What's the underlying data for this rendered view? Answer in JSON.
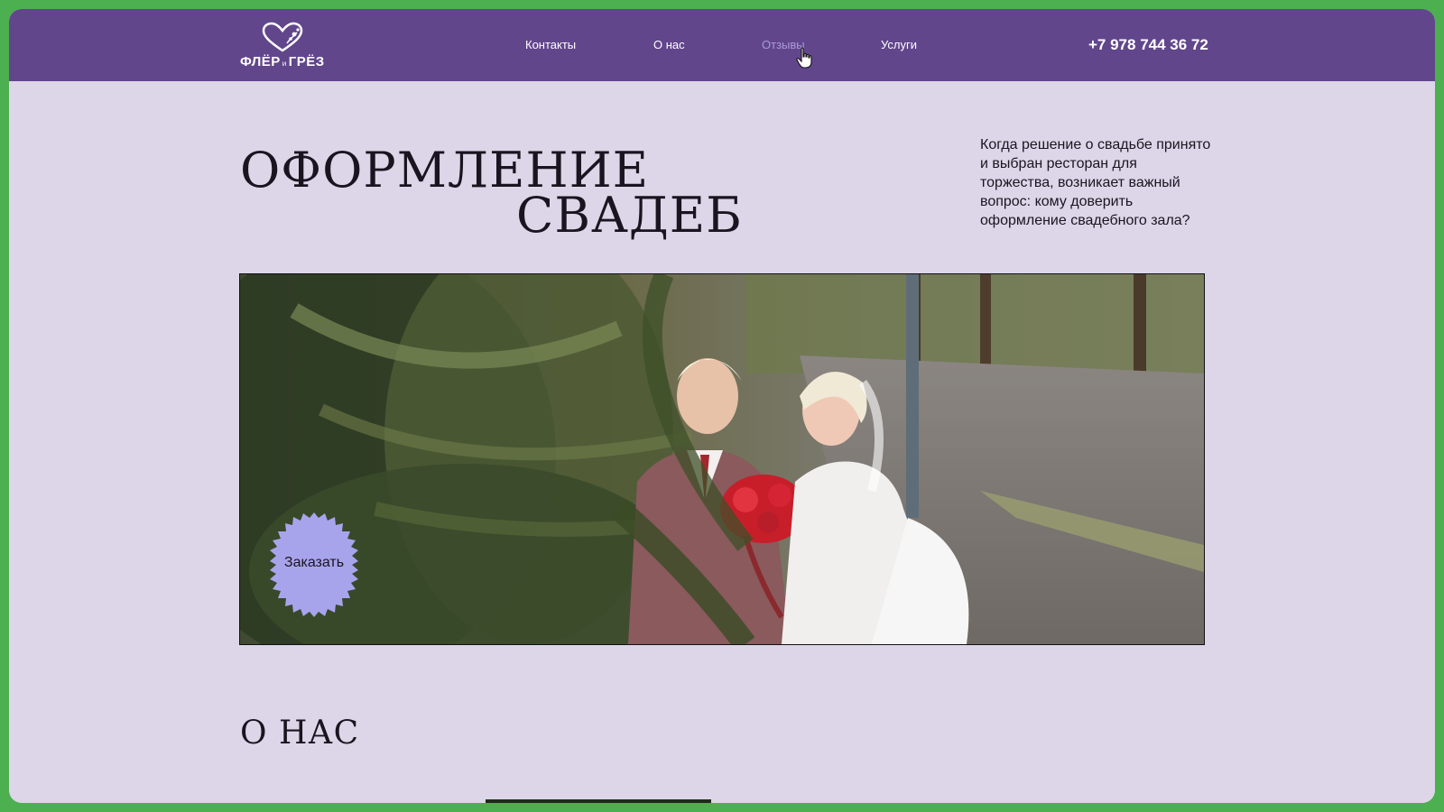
{
  "header": {
    "logo_text_left": "ФЛЁР",
    "logo_text_mid": "и",
    "logo_text_right": "ГРЁЗ",
    "nav": [
      {
        "label": "Контакты"
      },
      {
        "label": "О нас"
      },
      {
        "label": "Отзывы"
      },
      {
        "label": "Услуги"
      }
    ],
    "active_nav": "Отзывы",
    "phone": "+7 978 744 36 72"
  },
  "hero": {
    "title_line1": "ОФОРМЛЕНИЕ",
    "title_line2": "СВАДЕБ",
    "intro": "Когда решение о свадьбе принято и выбран ресторан для торжества, возникает важный вопрос: кому доверить оформление свадебного зала?",
    "image_icon": "wedding-couple-photo",
    "order_button": "Заказать"
  },
  "sections": {
    "about_title": "О НАС"
  },
  "colors": {
    "page_bg": "#dcd6e8",
    "header_bg": "#62468c",
    "accent": "#a99bd8",
    "order_badge": "#a8a4ec",
    "outer_frame": "#4caf50"
  }
}
